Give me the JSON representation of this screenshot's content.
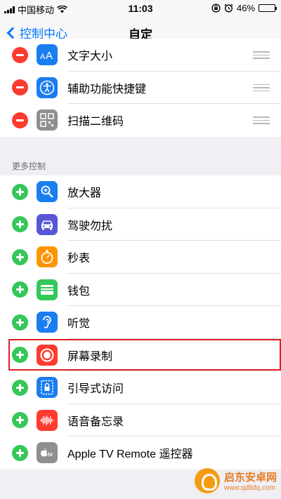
{
  "status": {
    "carrier": "中国移动",
    "time": "11:03",
    "battery": "46%",
    "battery_level": 0.46
  },
  "nav": {
    "back_label": "控制中心",
    "title": "自定"
  },
  "included": [
    {
      "label": "文字大小",
      "icon": "text-size-icon"
    },
    {
      "label": "辅助功能快捷键",
      "icon": "accessibility-icon"
    },
    {
      "label": "扫描二维码",
      "icon": "qr-code-icon"
    }
  ],
  "more_header": "更多控制",
  "more": [
    {
      "label": "放大器",
      "icon": "magnifier-icon"
    },
    {
      "label": "驾驶勿扰",
      "icon": "car-icon"
    },
    {
      "label": "秒表",
      "icon": "stopwatch-icon"
    },
    {
      "label": "钱包",
      "icon": "wallet-icon"
    },
    {
      "label": "听觉",
      "icon": "ear-icon"
    },
    {
      "label": "屏幕录制",
      "icon": "screen-record-icon"
    },
    {
      "label": "引导式访问",
      "icon": "guided-access-icon"
    },
    {
      "label": "语音备忘录",
      "icon": "voice-memo-icon"
    },
    {
      "label": "Apple TV Remote 遥控器",
      "icon": "apple-tv-icon"
    }
  ],
  "watermark": {
    "name": "启东安卓网",
    "url": "www.qdltdq.com"
  },
  "colors": {
    "accent": "#007aff",
    "remove": "#ff3b30",
    "add": "#34c759",
    "highlight": "#e02020"
  }
}
